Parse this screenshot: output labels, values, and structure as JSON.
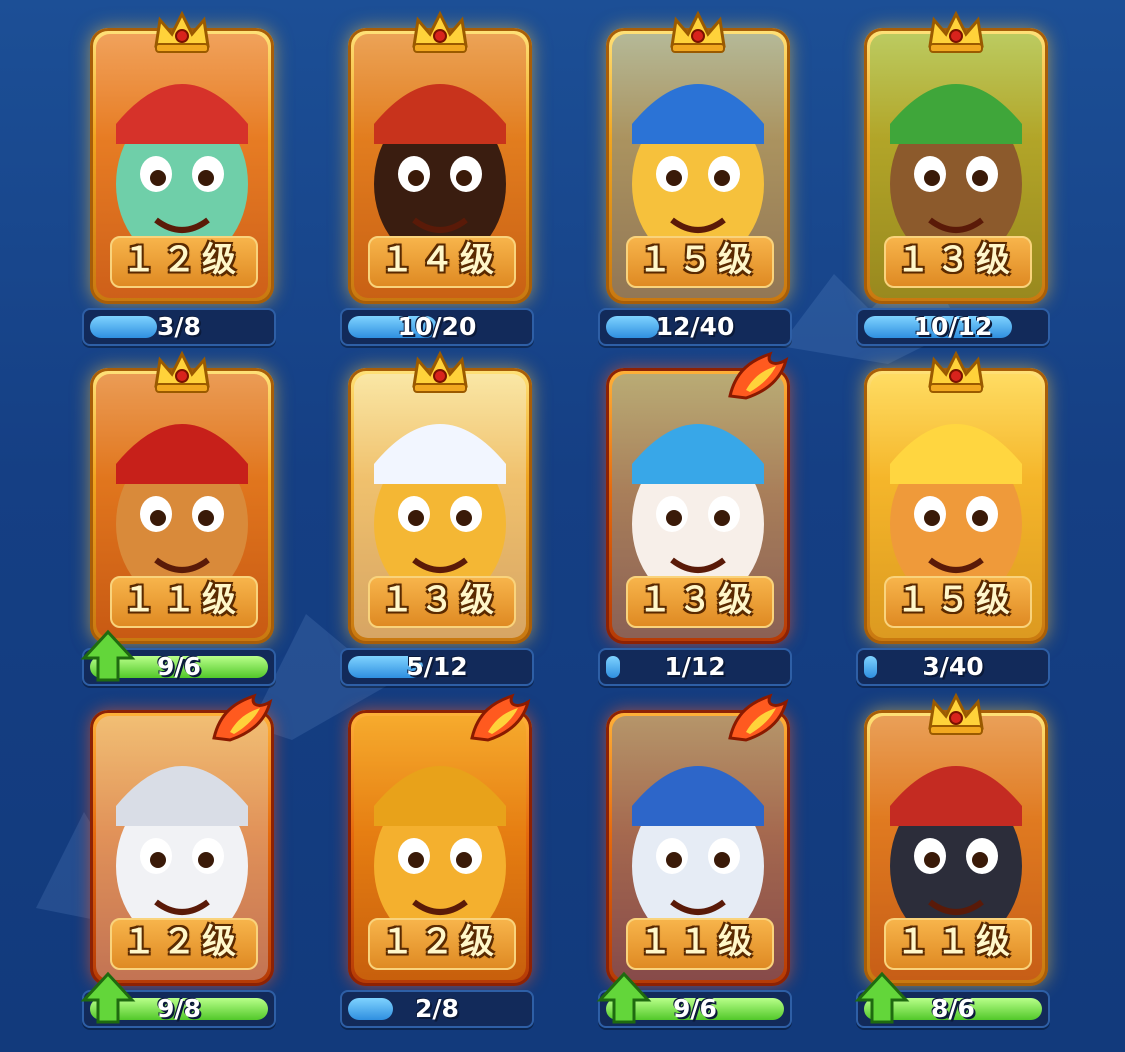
{
  "cards": [
    {
      "name": "police-cactus",
      "level": "１２级",
      "progress": "3/8",
      "ratio": 0.375,
      "frame": "gold",
      "top": "crown",
      "upgrade": false,
      "face": "#6fcfa9",
      "hat": "#d6322a"
    },
    {
      "name": "hooded-mage",
      "level": "１４级",
      "progress": "10/20",
      "ratio": 0.5,
      "frame": "gold",
      "top": "crown",
      "upgrade": false,
      "face": "#3a1d10",
      "hat": "#c8331c"
    },
    {
      "name": "blue-hat-bean",
      "level": "１５级",
      "progress": "12/40",
      "ratio": 0.3,
      "frame": "gold",
      "top": "crown",
      "upgrade": false,
      "face": "#f6c13c",
      "hat": "#2b73d6"
    },
    {
      "name": "tree-bandit",
      "level": "１３级",
      "progress": "10/12",
      "ratio": 0.83,
      "frame": "gold",
      "top": "crown",
      "upgrade": false,
      "face": "#8c5a2c",
      "hat": "#3fa63a"
    },
    {
      "name": "bull-warrior",
      "level": "１１级",
      "progress": "9/6",
      "ratio": 1.0,
      "frame": "gold",
      "top": "crown",
      "upgrade": true,
      "face": "#d98a3a",
      "hat": "#c7201a"
    },
    {
      "name": "masked-thief",
      "level": "１３级",
      "progress": "5/12",
      "ratio": 0.42,
      "frame": "gold",
      "top": "crown",
      "upgrade": false,
      "face": "#f4b734",
      "hat": "#f2f6ff"
    },
    {
      "name": "clown",
      "level": "１３级",
      "progress": "1/12",
      "ratio": 0.08,
      "frame": "red",
      "top": "flame",
      "upgrade": false,
      "face": "#f7efe9",
      "hat": "#38a7e8"
    },
    {
      "name": "spiky-hero",
      "level": "１５级",
      "progress": "3/40",
      "ratio": 0.075,
      "frame": "gold",
      "top": "crown",
      "upgrade": false,
      "face": "#ef9a3a",
      "hat": "#ffd640"
    },
    {
      "name": "ghost",
      "level": "１２级",
      "progress": "9/8",
      "ratio": 1.0,
      "frame": "red",
      "top": "flame",
      "upgrade": true,
      "face": "#f1f2f5",
      "hat": "#d9dde6"
    },
    {
      "name": "laurel-bean",
      "level": "１２级",
      "progress": "2/8",
      "ratio": 0.25,
      "frame": "red",
      "top": "flame",
      "upgrade": false,
      "face": "#f4b02e",
      "hat": "#e8a21a"
    },
    {
      "name": "robot",
      "level": "１１级",
      "progress": "9/6",
      "ratio": 1.0,
      "frame": "red",
      "top": "flame",
      "upgrade": true,
      "face": "#e6ecf5",
      "hat": "#2d66c9"
    },
    {
      "name": "dark-knight",
      "level": "１１级",
      "progress": "8/6",
      "ratio": 1.0,
      "frame": "gold",
      "top": "crown",
      "upgrade": true,
      "face": "#2c2d3a",
      "hat": "#c42b22"
    }
  ],
  "colors": {
    "background": "#153f84",
    "gold": "#f0a520",
    "progress_blue": "#2f8fe0",
    "progress_green": "#52c82a"
  },
  "icons": {
    "upgrade": "green-up-arrow-icon",
    "rank_gold": "crown-icon",
    "rank_red": "flame-wing-icon"
  }
}
